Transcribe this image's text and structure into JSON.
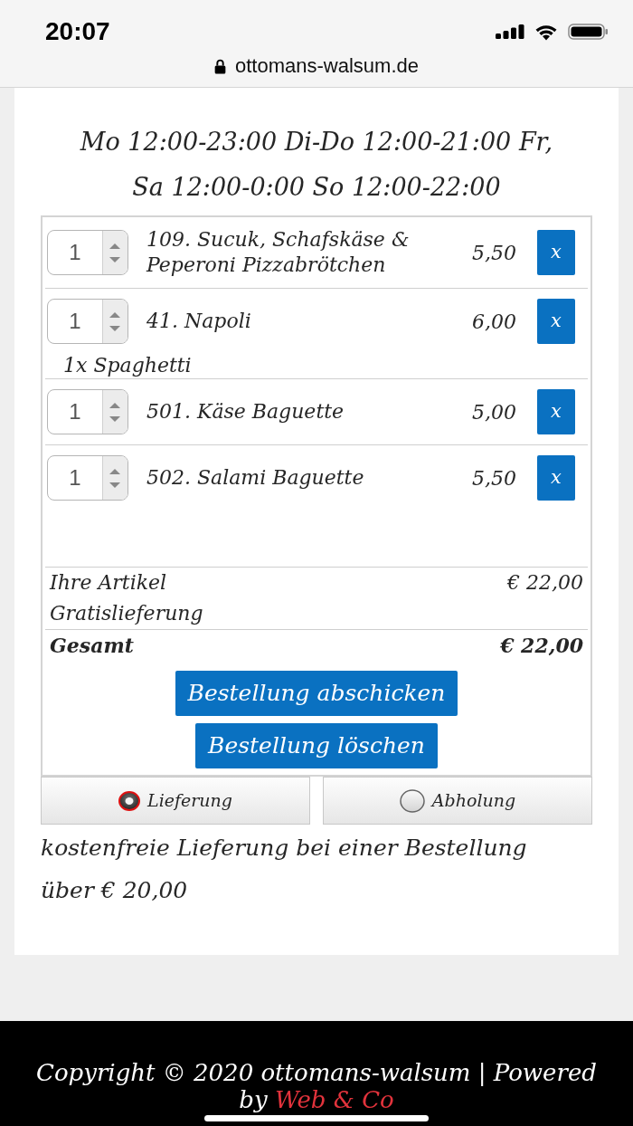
{
  "status_bar": {
    "time": "20:07"
  },
  "browser": {
    "url": "ottomans-walsum.de"
  },
  "opening_hours": [
    "Mo 12:00-23:00 Di-Do 12:00-21:00 Fr,",
    "Sa 12:00-0:00 So 12:00-22:00"
  ],
  "cart": {
    "items": [
      {
        "quantity": "1",
        "name": "109. Sucuk, Schafskäse & Peperoni Pizzabrötchen",
        "price": "5,50",
        "remove": "x"
      },
      {
        "quantity": "1",
        "name": "41. Napoli",
        "price": "6,00",
        "remove": "x",
        "extras": "1x Spaghetti"
      },
      {
        "quantity": "1",
        "name": "501. Käse Baguette",
        "price": "5,00",
        "remove": "x"
      },
      {
        "quantity": "1",
        "name": "502. Salami Baguette",
        "price": "5,50",
        "remove": "x"
      }
    ],
    "summary": [
      {
        "label": "Ihre Artikel",
        "value": "€ 22,00"
      },
      {
        "label": "Gratislieferung"
      }
    ],
    "total": {
      "label": "Gesamt",
      "value": "€ 22,00"
    },
    "buttons": [
      "Bestellung abschicken",
      "Bestellung löschen"
    ]
  },
  "delivery_options": [
    {
      "label": "Lieferung",
      "selected": true
    },
    {
      "label": "Abholung",
      "selected": false
    }
  ],
  "note": [
    "kostenfreie Lieferung bei einer Bestellung",
    "über € 20,00"
  ],
  "footer": {
    "text": "Copyright © 2020 ottomans-walsum | Powered by",
    "link": "Web & Co"
  }
}
